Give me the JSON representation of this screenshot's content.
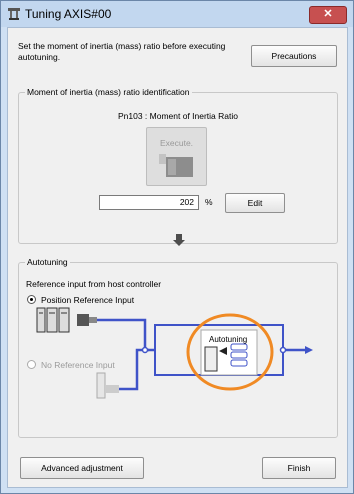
{
  "window": {
    "title": "Tuning AXIS#00",
    "close_symbol": "✕"
  },
  "intro": {
    "text": "Set the moment of inertia (mass) ratio before executing autotuning.",
    "precautions_label": "Precautions"
  },
  "inertia_group": {
    "label": "Moment of inertia (mass) ratio identification",
    "parameter_text": "Pn103 : Moment of Inertia Ratio",
    "execute_label": "Execute.",
    "value": "202",
    "unit": "%",
    "edit_label": "Edit"
  },
  "autotuning_group": {
    "label": "Autotuning",
    "reference_heading": "Reference input from host controller",
    "option_position": "Position Reference Input",
    "option_none": "No Reference Input",
    "box_label": "Autotuning",
    "selected_option": "Position Reference Input"
  },
  "footer": {
    "advanced_label": "Advanced adjustment",
    "finish_label": "Finish"
  },
  "colors": {
    "flow_line": "#3f53c8",
    "highlight_ring": "#f08a24",
    "titlebar": "#c2d7ef",
    "close_button": "#c75050"
  },
  "icons": [
    "tuning-window-icon",
    "close-icon",
    "down-arrow-icon",
    "controller-icon",
    "servo-motor-icon",
    "autotuning-block-icon"
  ]
}
